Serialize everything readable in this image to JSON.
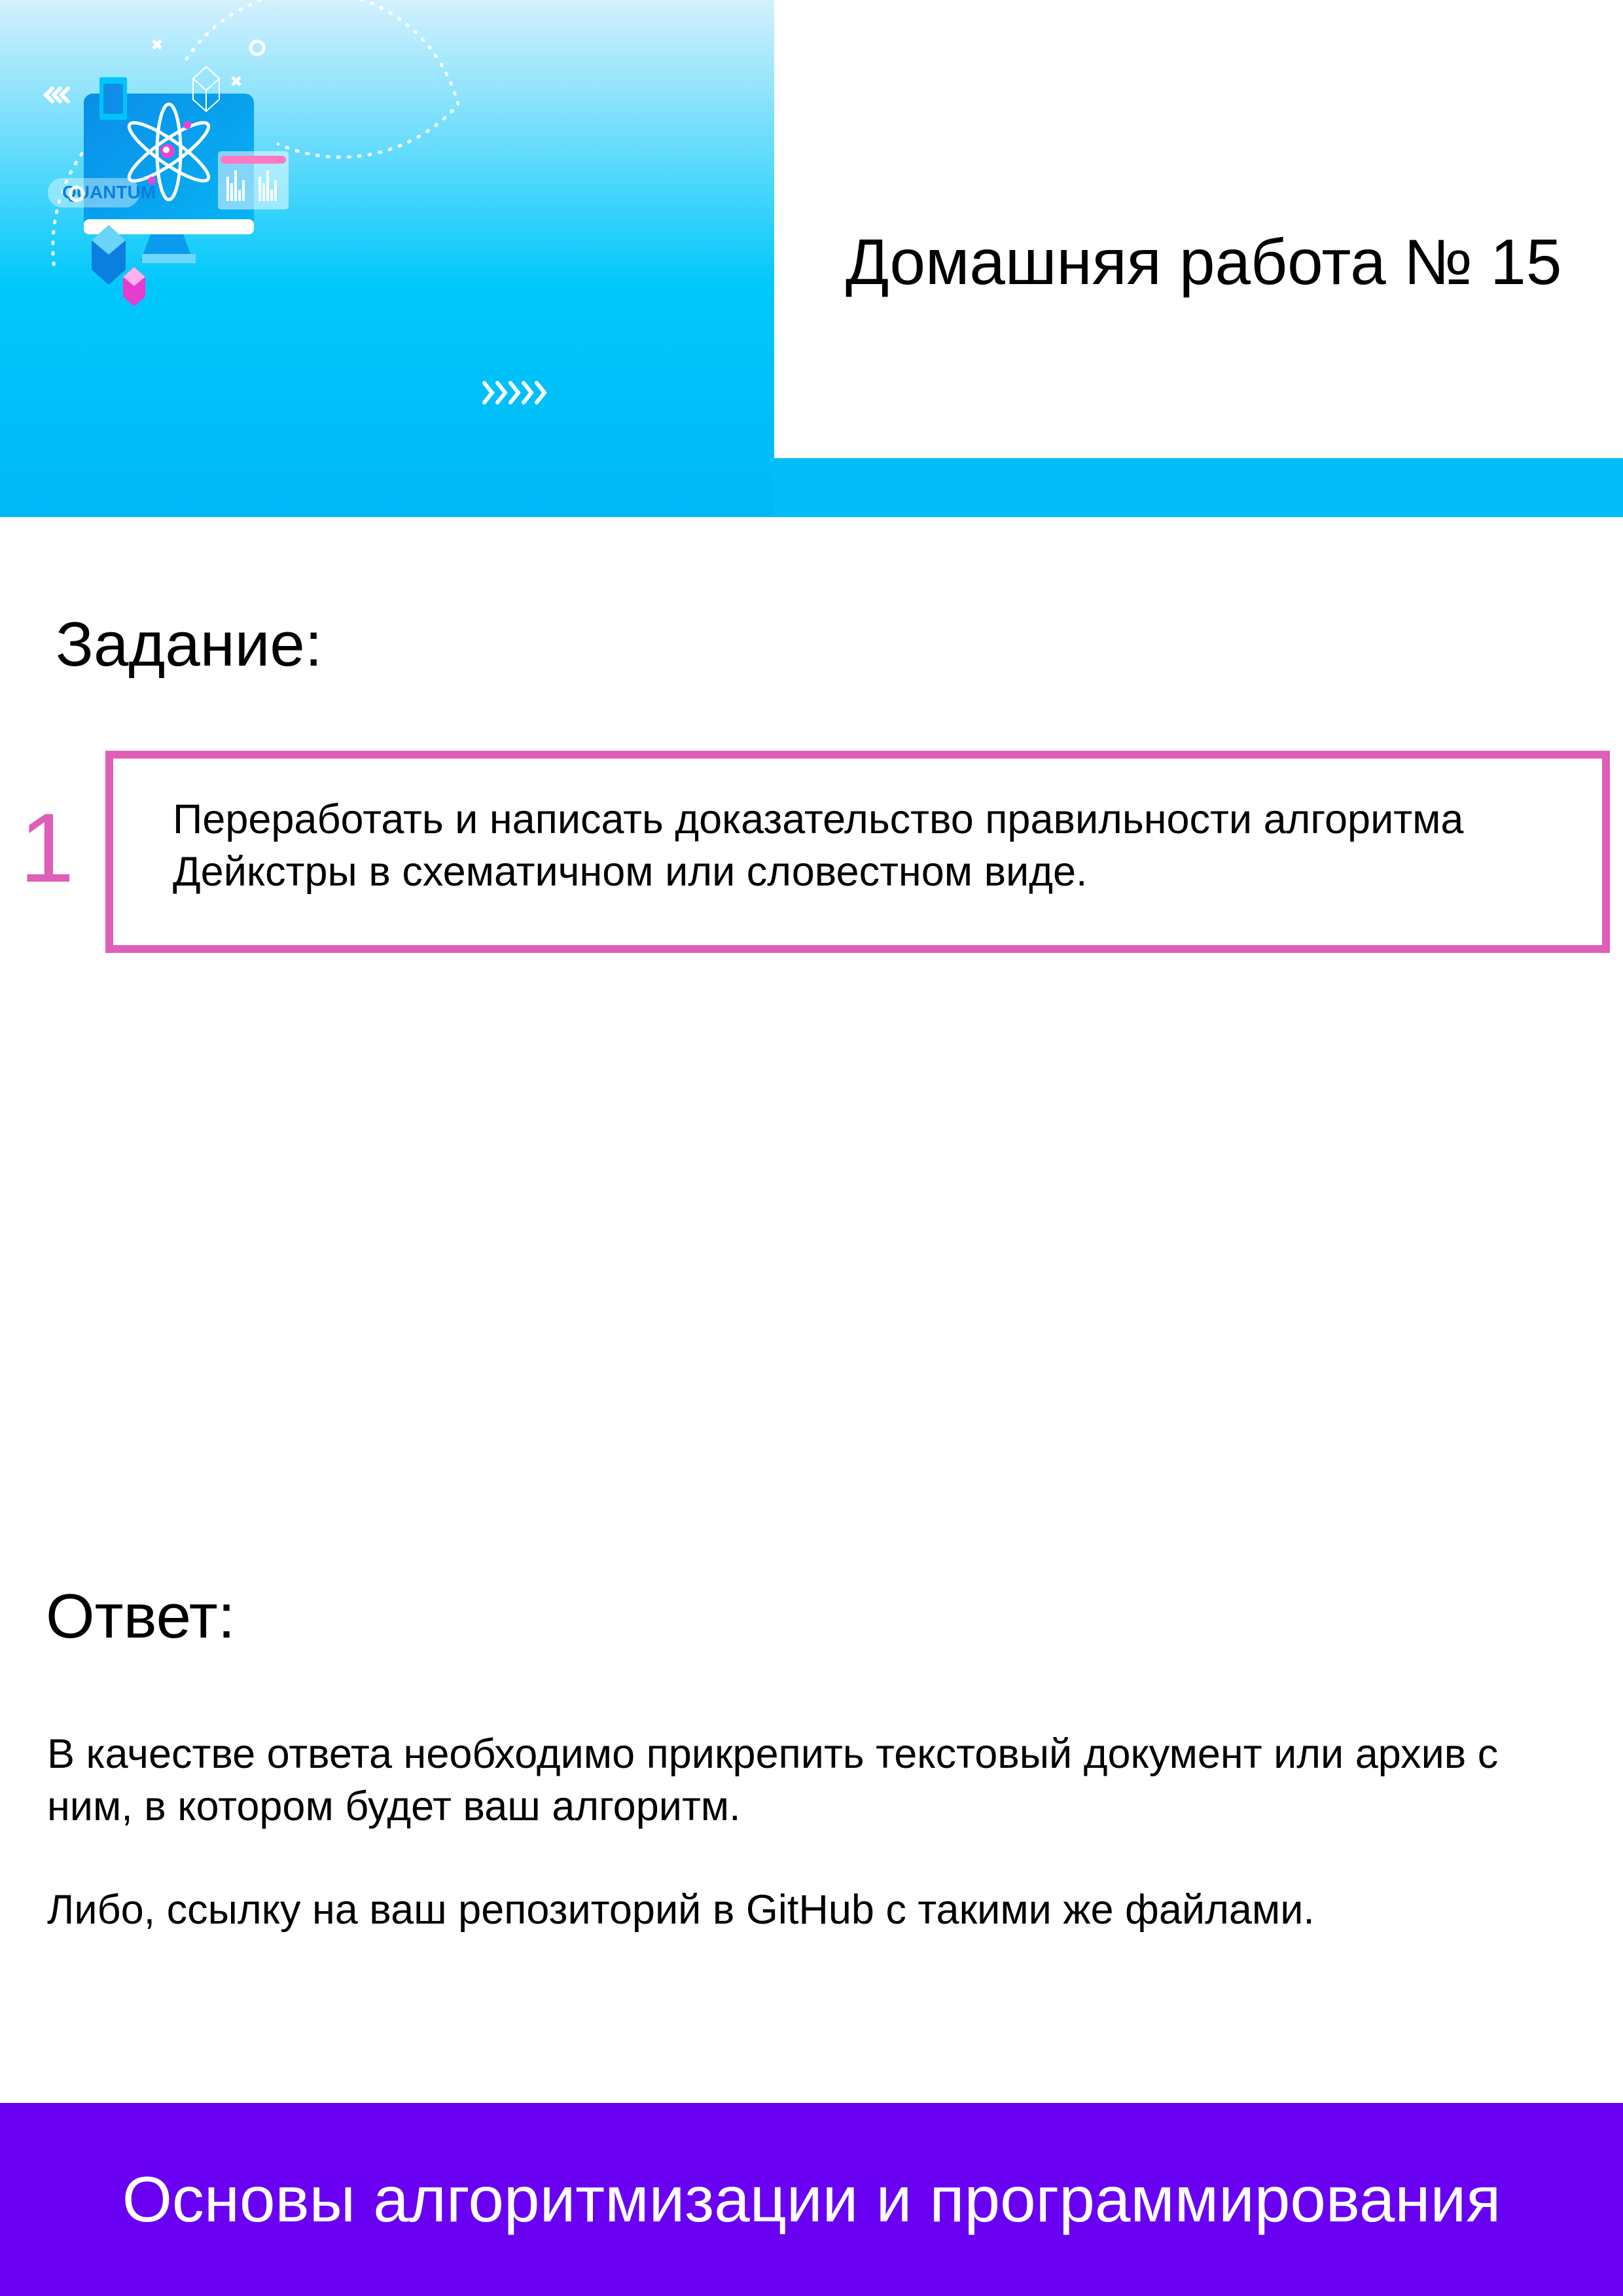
{
  "header": {
    "illustration_label": "QUANTUM",
    "title": "Домашняя работа № 15"
  },
  "task": {
    "heading": "Задание:",
    "number": "1",
    "text": "Переработать и написать доказательство правильности алгоритма Дейкстры в схематичном или словестном виде."
  },
  "answer": {
    "heading": "Ответ:",
    "paragraphs": [
      "В качестве ответа необходимо прикрепить текстовый документ или архив с ним, в котором будет ваш алгоритм.",
      "Либо, ссылку на ваш репозиторий в GitHub с такими же файлами."
    ]
  },
  "footer": {
    "course": "Основы алгоритмизации и программирования"
  },
  "colors": {
    "accent_pink": "#df5fb8",
    "cyan": "#02bdf8",
    "footer_purple": "#6a00f2"
  }
}
